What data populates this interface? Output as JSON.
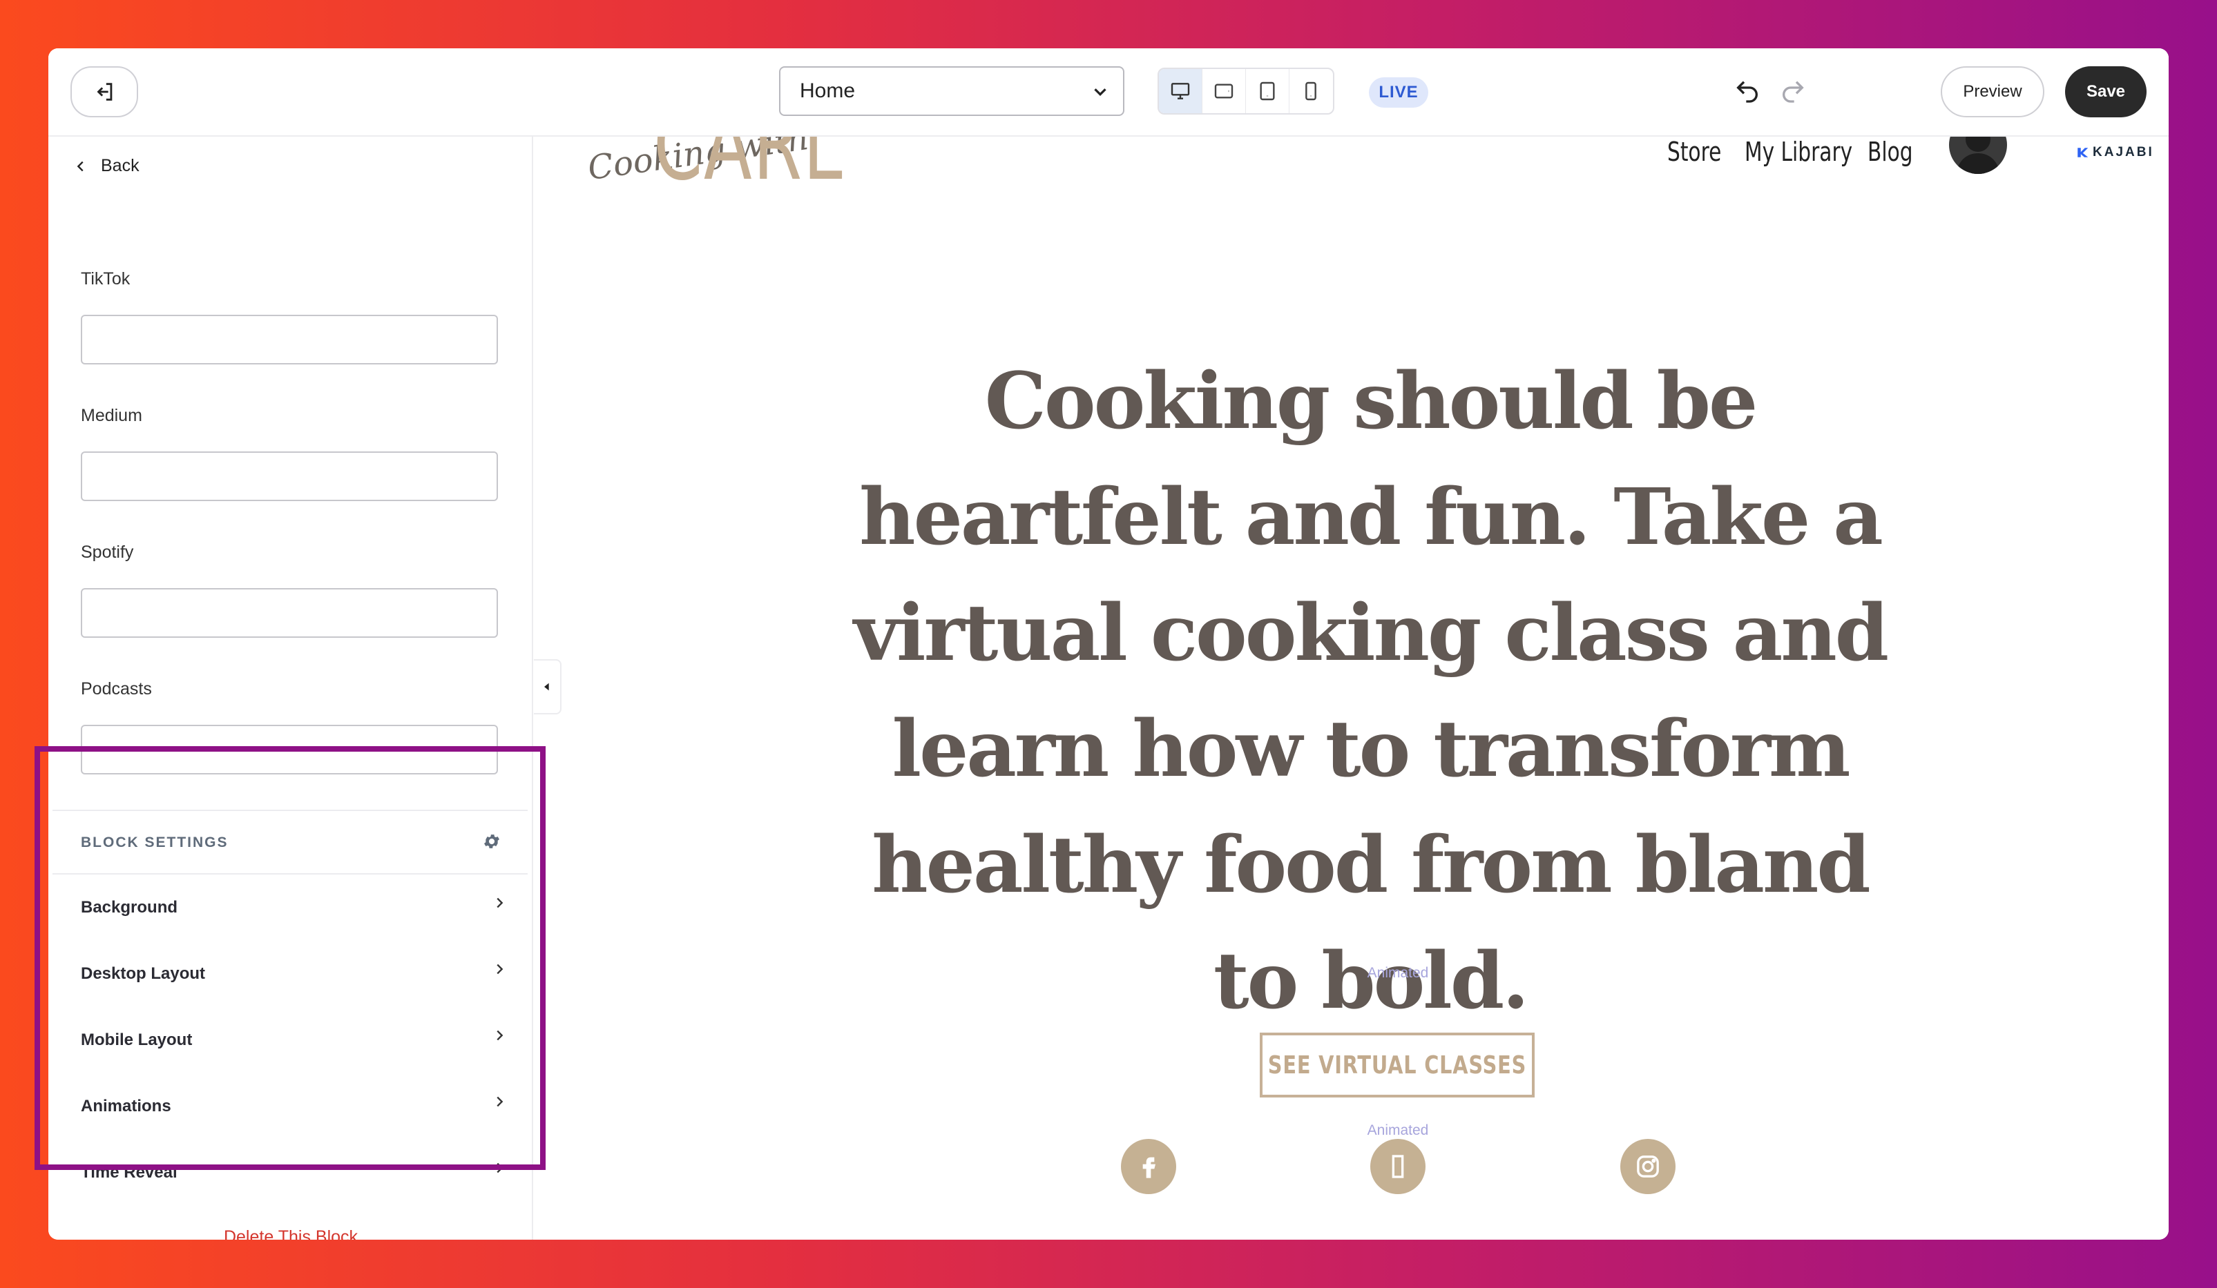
{
  "topbar": {
    "exit_icon": "exit-icon",
    "page_select": {
      "selected": "Home"
    },
    "devices": [
      "desktop-icon",
      "tablet-landscape-icon",
      "tablet-portrait-icon",
      "mobile-icon"
    ],
    "live_label": "LIVE",
    "preview_label": "Preview",
    "save_label": "Save"
  },
  "sidebar": {
    "back_label": "Back",
    "fields": [
      {
        "label": "TikTok",
        "value": ""
      },
      {
        "label": "Medium",
        "value": ""
      },
      {
        "label": "Spotify",
        "value": ""
      },
      {
        "label": "Podcasts",
        "value": ""
      }
    ],
    "block_settings": {
      "title": "BLOCK SETTINGS",
      "items": [
        "Background",
        "Desktop Layout",
        "Mobile Layout",
        "Animations",
        "Time Reveal"
      ]
    },
    "delete_label": "Delete This Block"
  },
  "preview": {
    "logo_script": "Cooking with",
    "logo_main": "CARL",
    "nav": [
      "Store",
      "My Library",
      "Blog"
    ],
    "brand": "KAJABI",
    "headline": "Cooking should be heartfelt and fun. Take a virtual cooking class and learn how to transform healthy food from bland to bold.",
    "animated_label": "Animated",
    "cta_label": "SEE VIRTUAL CLASSES",
    "social": [
      "facebook-icon",
      "unknown-icon",
      "instagram-icon"
    ]
  },
  "colors": {
    "highlight": "#8e1186",
    "accent_tan": "#c5b193",
    "headline": "#625954",
    "delete": "#d4362d",
    "save_bg": "#2a2a2a",
    "live_bg": "#dfe7fb"
  }
}
